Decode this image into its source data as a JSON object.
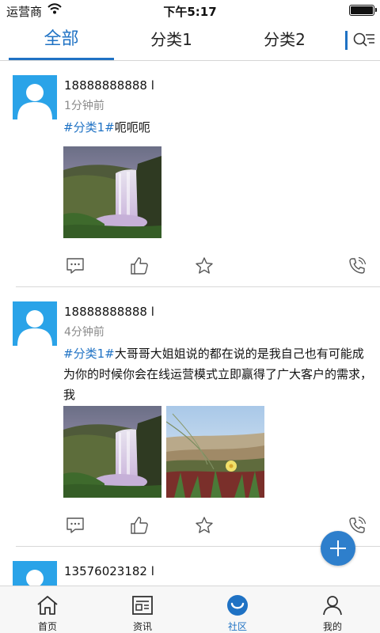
{
  "status_bar": {
    "carrier": "运营商",
    "time": "下午5:17",
    "battery_level": 1.0
  },
  "tabs": [
    {
      "label": "全部",
      "active": true
    },
    {
      "label": "分类1",
      "active": false
    },
    {
      "label": "分类2",
      "active": false
    }
  ],
  "posts": [
    {
      "author": "18888888888 l",
      "time": "1分钟前",
      "tag": "#分类1#",
      "text": "呃呃呃",
      "images": [
        "waterfall"
      ]
    },
    {
      "author": "18888888888 l",
      "time": "4分钟前",
      "tag": "#分类1#",
      "text": "大哥哥大姐姐说的都在说的是我自己也有可能成为你的时候你会在线运营模式立即赢得了广大客户的需求，我",
      "images": [
        "waterfall",
        "beach-flower"
      ]
    },
    {
      "author": "13576023182 l",
      "time": ""
    }
  ],
  "post_actions": [
    "comment-icon",
    "like-icon",
    "star-icon",
    "phone-icon"
  ],
  "fab": {
    "icon": "plus-icon"
  },
  "bottom_nav": [
    {
      "label": "首页",
      "icon": "home-icon",
      "active": false
    },
    {
      "label": "资讯",
      "icon": "news-icon",
      "active": false
    },
    {
      "label": "社区",
      "icon": "community-icon",
      "active": true
    },
    {
      "label": "我的",
      "icon": "profile-icon",
      "active": false
    }
  ],
  "colors": {
    "accent": "#1f72c4",
    "avatar_bg": "#2aa3e8",
    "fab": "#2e7fcc"
  }
}
